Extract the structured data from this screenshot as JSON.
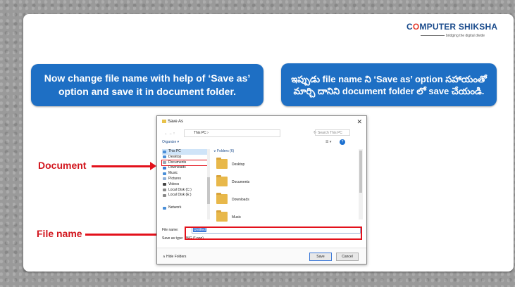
{
  "logo": {
    "brand_part1": "C",
    "brand_o": "O",
    "brand_part2": "MPUTER SHIKSHA",
    "tagline": "bridging the digital divide"
  },
  "callouts": {
    "english": "Now change file name with help of ‘Save as’ option and save it in document folder.",
    "telugu": "ఇప్పుడు file name ని ‘Save as’ option సహాయంతో మార్చి దానిని document folder లో save చేయండి."
  },
  "labels": {
    "document": "Document",
    "file_name": "File name"
  },
  "dialog": {
    "title": "Save As",
    "close": "✕",
    "address": {
      "nav": "← → ↑",
      "crumb": "This PC ›",
      "refresh": "↻",
      "search_placeholder": "Search This PC"
    },
    "toolbar": {
      "organize": "Organize ▾",
      "view": "☰ ▾",
      "help": "?"
    },
    "nav_items": [
      {
        "label": "This PC",
        "color": "#4a8fd8"
      },
      {
        "label": "Desktop",
        "color": "#4a8fd8"
      },
      {
        "label": "Documents",
        "color": "#9aa6b5"
      },
      {
        "label": "Downloads",
        "color": "#3a7bd5"
      },
      {
        "label": "Music",
        "color": "#4a8fd8"
      },
      {
        "label": "Pictures",
        "color": "#8fb0d8"
      },
      {
        "label": "Videos",
        "color": "#444444"
      },
      {
        "label": "Local Disk (C:)",
        "color": "#888888"
      },
      {
        "label": "Local Disk (E:)",
        "color": "#888888"
      },
      {
        "label": "Network",
        "color": "#4a8fd8"
      }
    ],
    "folders_header": "∨ Folders (6)",
    "folders": [
      {
        "label": "Desktop"
      },
      {
        "label": "Documents"
      },
      {
        "label": "Downloads"
      },
      {
        "label": "Music"
      }
    ],
    "file_name_label": "File name:",
    "file_name_value": "Untitled",
    "save_as_type": "Save as type:  PNG (*.png)",
    "hide_folders": "∧  Hide Folders",
    "save_button": "Save",
    "cancel_button": "Cancel"
  }
}
